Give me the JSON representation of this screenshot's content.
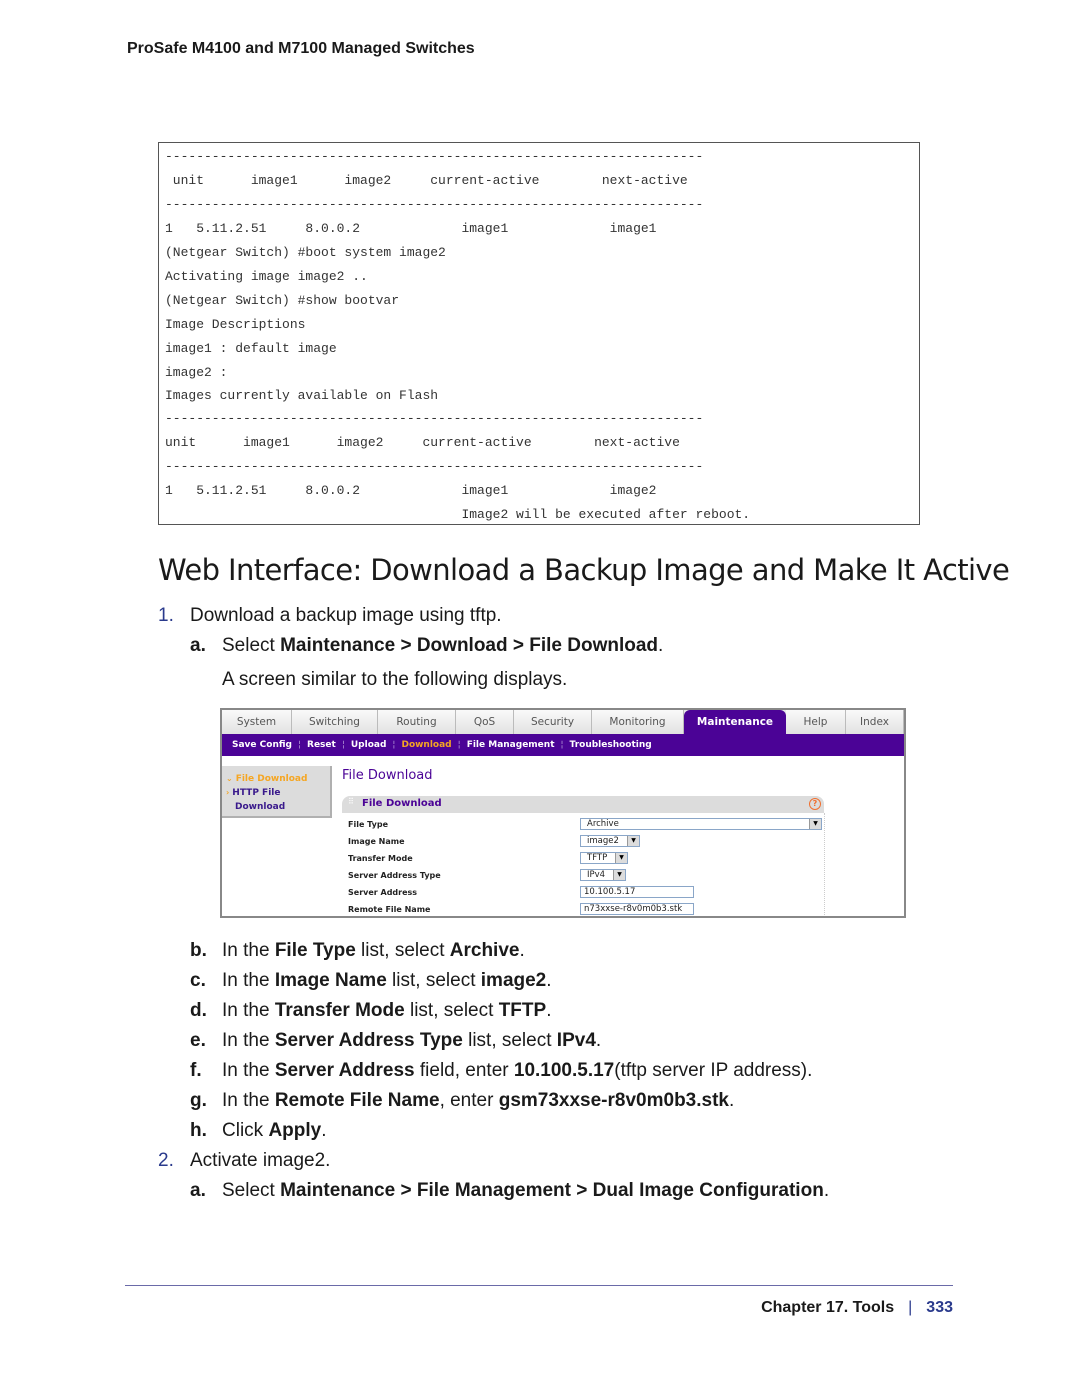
{
  "running_header": "ProSafe M4100 and M7100 Managed Switches",
  "cli_output": [
    "---------------------------------------------------------------------",
    " unit      image1      image2     current-active        next-active",
    "---------------------------------------------------------------------",
    "1   5.11.2.51     8.0.0.2             image1             image1",
    "(Netgear Switch) #boot system image2",
    "Activating image image2 ..",
    "(Netgear Switch) #show bootvar",
    "Image Descriptions",
    "image1 : default image",
    "image2 :",
    "Images currently available on Flash",
    "---------------------------------------------------------------------",
    "unit      image1      image2     current-active        next-active",
    "---------------------------------------------------------------------",
    "1   5.11.2.51     8.0.0.2             image1             image2",
    "                                      Image2 will be executed after reboot."
  ],
  "section_title": "Web Interface: Download a Backup Image and Make It Active",
  "steps": {
    "s1": {
      "num": "1.",
      "text": "Download a backup image using tftp."
    },
    "s1a": {
      "letter": "a.",
      "pre": "Select ",
      "b1": "Maintenance > Download > File Download",
      "post": "."
    },
    "s1a_note": "A screen similar to the following displays.",
    "s1b": {
      "letter": "b.",
      "pre": "In the ",
      "b1": "File Type",
      "mid": " list, select ",
      "b2": "Archive",
      "post": "."
    },
    "s1c": {
      "letter": "c.",
      "pre": "In the ",
      "b1": "Image Name",
      "mid": " list, select ",
      "b2": "image2",
      "post": "."
    },
    "s1d": {
      "letter": "d.",
      "pre": "In the ",
      "b1": "Transfer Mode",
      "mid": " list, select ",
      "b2": "TFTP",
      "post": "."
    },
    "s1e": {
      "letter": "e.",
      "pre": "In the ",
      "b1": "Server Address Type",
      "mid": " list, select ",
      "b2": "IPv4",
      "post": "."
    },
    "s1f": {
      "letter": "f.",
      "pre": "In the ",
      "b1": "Server Address",
      "mid": " field, enter ",
      "b2": "10.100.5.17",
      "post": "(tftp server IP address)."
    },
    "s1g": {
      "letter": "g.",
      "pre": "In the ",
      "b1": "Remote File Name",
      "mid": ", enter ",
      "b2": "gsm73xxse-r8v0m0b3.stk",
      "post": "."
    },
    "s1h": {
      "letter": "h.",
      "pre": "Click ",
      "b1": "Apply",
      "post": "."
    },
    "s2": {
      "num": "2.",
      "text": "Activate image2."
    },
    "s2a": {
      "letter": "a.",
      "pre": "Select ",
      "b1": "Maintenance > File Management > Dual Image Configuration",
      "post": "."
    }
  },
  "web_ui": {
    "tabs": [
      "System",
      "Switching",
      "Routing",
      "QoS",
      "Security",
      "Monitoring",
      "Maintenance",
      "Help",
      "Index"
    ],
    "active_tab": "Maintenance",
    "subnav": [
      "Save Config",
      "Reset",
      "Upload",
      "Download",
      "File Management",
      "Troubleshooting"
    ],
    "active_subnav": "Download",
    "sidebar": {
      "active": "File Download",
      "link_line1": "HTTP File",
      "link_line2": "Download"
    },
    "page_heading": "File Download",
    "panel_title": "File Download",
    "help_glyph": "?",
    "fields": [
      {
        "label": "File Type",
        "value": "Archive"
      },
      {
        "label": "Image Name",
        "value": "image2"
      },
      {
        "label": "Transfer Mode",
        "value": "TFTP"
      },
      {
        "label": "Server Address Type",
        "value": "IPv4"
      },
      {
        "label": "Server Address",
        "value": "10.100.5.17"
      },
      {
        "label": "Remote File Name",
        "value": "n73xxse-r8v0m0b3.stk"
      }
    ],
    "colors": {
      "brand_purple": "#4b0396",
      "active_orange": "#f5a623"
    }
  },
  "footer": {
    "chapter": "Chapter 17.  Tools",
    "page": "333"
  }
}
